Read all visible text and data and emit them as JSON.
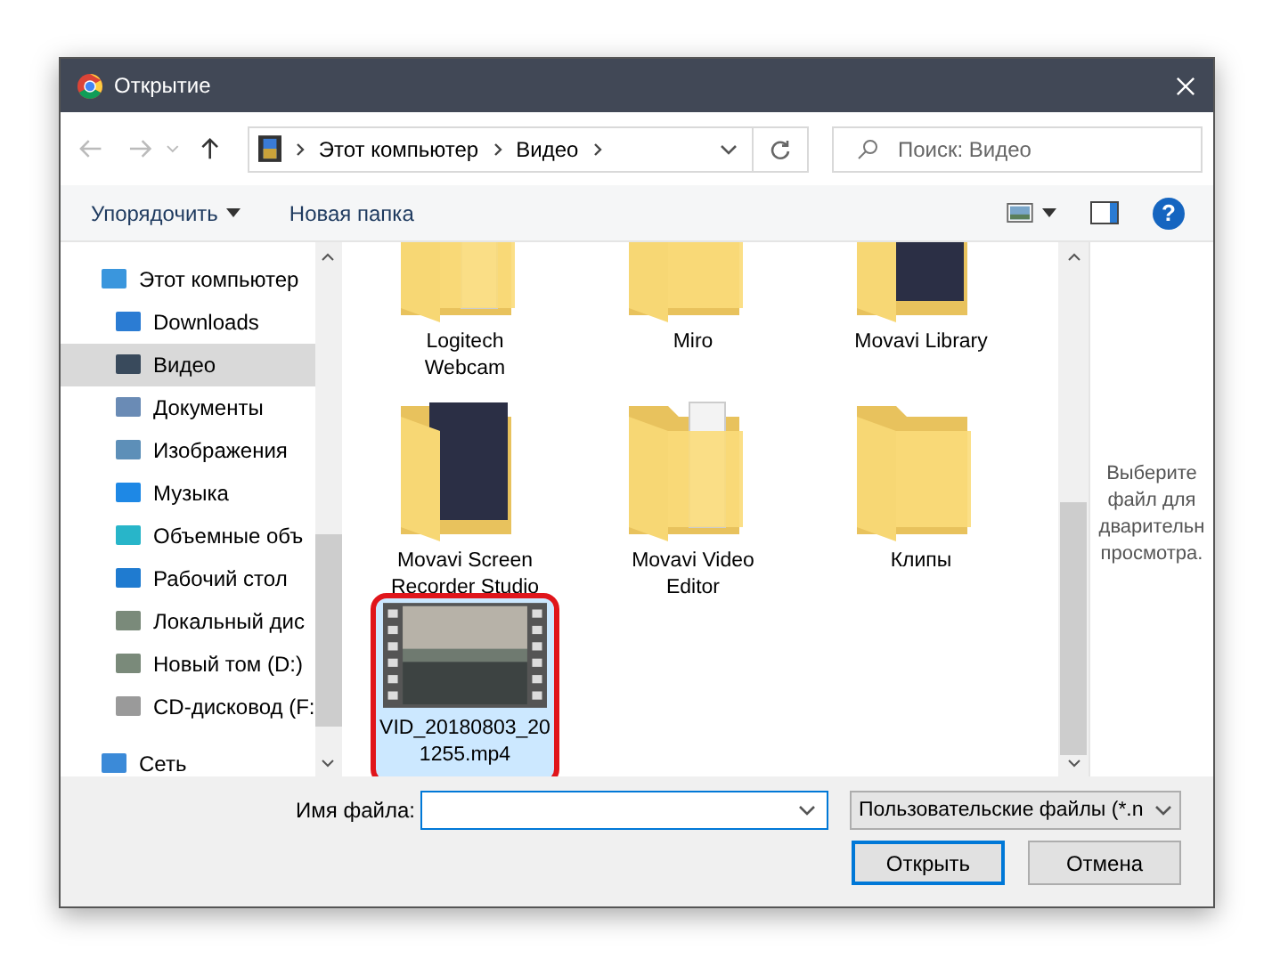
{
  "window": {
    "title": "Открытие"
  },
  "address": {
    "crumbs": [
      "Этот компьютер",
      "Видео"
    ],
    "search_placeholder": "Поиск: Видео"
  },
  "toolbar": {
    "organize": "Упорядочить",
    "new_folder": "Новая папка",
    "help": "?"
  },
  "sidebar": {
    "items": [
      {
        "label": "Этот компьютер",
        "selected": false,
        "children": [
          {
            "label": "Downloads",
            "selected": false
          },
          {
            "label": "Видео",
            "selected": true
          },
          {
            "label": "Документы",
            "selected": false
          },
          {
            "label": "Изображения",
            "selected": false
          },
          {
            "label": "Музыка",
            "selected": false
          },
          {
            "label": "Объемные объ",
            "selected": false
          },
          {
            "label": "Рабочий стол",
            "selected": false
          },
          {
            "label": "Локальный дис",
            "selected": false
          },
          {
            "label": "Новый том (D:)",
            "selected": false
          },
          {
            "label": "CD-дисковод (F:",
            "selected": false
          }
        ]
      },
      {
        "label": "Сеть",
        "selected": false
      }
    ]
  },
  "files": [
    {
      "name": "Logitech Webcam",
      "kind": "folder-docs",
      "selected": false
    },
    {
      "name": "Miro",
      "kind": "folder",
      "selected": false
    },
    {
      "name": "Movavi Library",
      "kind": "folder-media",
      "selected": false
    },
    {
      "name": "Movavi Screen Recorder Studio",
      "kind": "folder-media",
      "selected": false
    },
    {
      "name": "Movavi Video Editor",
      "kind": "folder-docs",
      "selected": false
    },
    {
      "name": "Клипы",
      "kind": "folder",
      "selected": false
    },
    {
      "name": "VID_20180803_201255.mp4",
      "kind": "video",
      "selected": true
    }
  ],
  "preview": {
    "lines": [
      "Выберите",
      "файл для",
      "дварительн",
      "просмотра."
    ]
  },
  "bottom": {
    "filename_label": "Имя файла:",
    "filter": "Пользовательские файлы (*.n",
    "open": "Открыть",
    "cancel": "Отмена"
  }
}
